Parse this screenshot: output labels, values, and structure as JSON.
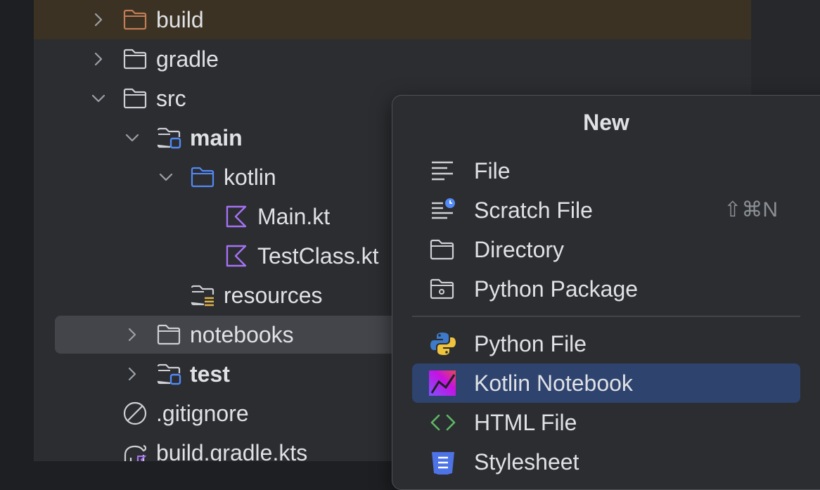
{
  "project_tree": {
    "items": [
      {
        "label": "build",
        "kind": "folder-excluded",
        "expanded": false
      },
      {
        "label": "gradle",
        "kind": "folder",
        "expanded": false
      },
      {
        "label": "src",
        "kind": "folder",
        "expanded": true
      },
      {
        "label": "main",
        "kind": "source-root",
        "expanded": true
      },
      {
        "label": "kotlin",
        "kind": "source-folder",
        "expanded": true
      },
      {
        "label": "Main.kt",
        "kind": "kotlin-file"
      },
      {
        "label": "TestClass.kt",
        "kind": "kotlin-file"
      },
      {
        "label": "resources",
        "kind": "resources-folder"
      },
      {
        "label": "notebooks",
        "kind": "folder",
        "expanded": false,
        "selected": true
      },
      {
        "label": "test",
        "kind": "source-root",
        "expanded": false
      },
      {
        "label": ".gitignore",
        "kind": "ignore-file"
      },
      {
        "label": "build.gradle.kts",
        "kind": "gradle-file"
      }
    ]
  },
  "new_menu": {
    "title": "New",
    "items": [
      {
        "label": "File",
        "icon": "text-file-icon",
        "shortcut": ""
      },
      {
        "label": "Scratch File",
        "icon": "scratch-file-icon",
        "shortcut": "⇧⌘N"
      },
      {
        "label": "Directory",
        "icon": "folder-icon",
        "shortcut": ""
      },
      {
        "label": "Python Package",
        "icon": "python-package-icon",
        "shortcut": ""
      },
      {
        "label": "Python File",
        "icon": "python-icon",
        "shortcut": ""
      },
      {
        "label": "Kotlin Notebook",
        "icon": "kotlin-notebook-icon",
        "shortcut": "",
        "highlighted": true
      },
      {
        "label": "HTML File",
        "icon": "html-icon",
        "shortcut": ""
      },
      {
        "label": "Stylesheet",
        "icon": "css-icon",
        "shortcut": ""
      }
    ]
  },
  "colors": {
    "panel_bg": "#2b2d30",
    "excluded_row_bg": "#3b3223",
    "selected_row_bg": "#43454a",
    "menu_highlight_bg": "#2e436e",
    "folder_excluded": "#c27d56",
    "source_folder": "#548af7",
    "kotlin": "#a572f4",
    "html_green": "#5fb865"
  }
}
